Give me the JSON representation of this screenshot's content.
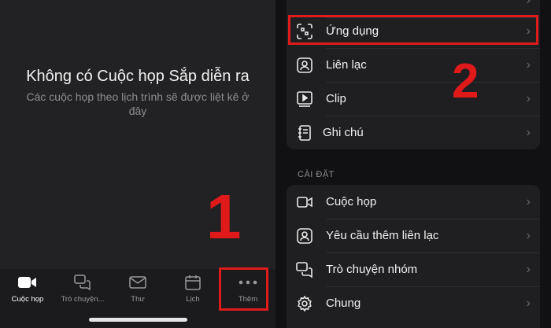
{
  "meetings": {
    "empty_title": "Không có Cuộc họp Sắp diễn ra",
    "empty_subtitle": "Các cuộc họp theo lịch trình sẽ được liệt kê ở đây"
  },
  "tabbar": {
    "tabs": [
      {
        "label": "Cuộc họp",
        "icon": "video-camera-icon",
        "active": true
      },
      {
        "label": "Trò chuyện...",
        "icon": "chat-bubbles-icon",
        "active": false
      },
      {
        "label": "Thư",
        "icon": "mail-icon",
        "active": false
      },
      {
        "label": "Lịch",
        "icon": "calendar-icon",
        "active": false
      },
      {
        "label": "Thêm",
        "icon": "more-dots-icon",
        "active": false
      }
    ]
  },
  "more_menu": {
    "features": [
      {
        "label": "Ứng dụng",
        "icon": "apps-icon"
      },
      {
        "label": "Liên lạc",
        "icon": "contacts-icon"
      },
      {
        "label": "Clip",
        "icon": "clip-icon"
      },
      {
        "label": "Ghi chú",
        "icon": "notes-icon"
      }
    ],
    "settings_header": "CÀI ĐẶT",
    "settings": [
      {
        "label": "Cuộc họp",
        "icon": "video-camera-icon"
      },
      {
        "label": "Yêu cầu thêm liên lạc",
        "icon": "contact-request-icon"
      },
      {
        "label": "Trò chuyện nhóm",
        "icon": "chat-bubbles-icon"
      },
      {
        "label": "Chung",
        "icon": "gear-icon"
      }
    ]
  },
  "annotations": {
    "step1": "1",
    "step2": "2"
  },
  "colors": {
    "highlight": "#e01b1b",
    "background": "#222224"
  }
}
